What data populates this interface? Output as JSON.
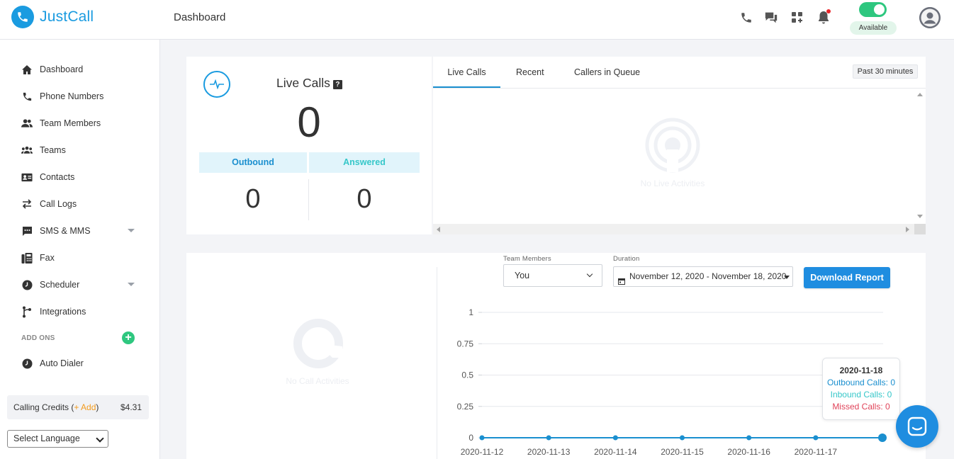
{
  "app": {
    "name": "JustCall"
  },
  "header": {
    "page_title": "Dashboard",
    "status_label": "Available",
    "icons": [
      "phone-icon",
      "chat-icon",
      "apps-icon",
      "bell-icon",
      "avatar-icon"
    ],
    "toggle_color": "#2ec77f",
    "accent": "#1a9be0"
  },
  "sidebar": {
    "items": [
      {
        "label": "Dashboard",
        "icon": "home-icon"
      },
      {
        "label": "Phone Numbers",
        "icon": "phone-icon"
      },
      {
        "label": "Team Members",
        "icon": "team-members-icon"
      },
      {
        "label": "Teams",
        "icon": "teams-icon"
      },
      {
        "label": "Contacts",
        "icon": "contacts-icon"
      },
      {
        "label": "Call Logs",
        "icon": "arrows-icon"
      },
      {
        "label": "SMS & MMS",
        "icon": "sms-icon"
      },
      {
        "label": "Fax",
        "icon": "fax-icon"
      },
      {
        "label": "Scheduler",
        "icon": "clock-icon"
      },
      {
        "label": "Integrations",
        "icon": "integrations-icon"
      }
    ],
    "addons_label": "ADD ONS",
    "addons_plus": "+",
    "addons": [
      {
        "label": "Auto Dialer",
        "icon": "clock-icon"
      }
    ],
    "credits": {
      "label": "Calling Credits (",
      "add": "+ Add",
      "close": ")",
      "amount": "$4.31"
    },
    "language": "Select Language"
  },
  "live_calls": {
    "title": "Live Calls",
    "help": "?",
    "count": "0",
    "outbound_label": "Outbound",
    "answered_label": "Answered",
    "outbound_count": "0",
    "answered_count": "0"
  },
  "activity": {
    "tabs": [
      {
        "label": "Live Calls"
      },
      {
        "label": "Recent"
      },
      {
        "label": "Callers in Queue"
      }
    ],
    "active_tab": "Live Calls",
    "range_button": "Past 30 minutes",
    "empty_text": "No Live Activities"
  },
  "report": {
    "empty_text": "No Call Activities",
    "team_members_label": "Team Members",
    "team_members_value": "You",
    "duration_label": "Duration",
    "duration_value": "November 12, 2020 - November 18, 2020",
    "download_label": "Download Report",
    "tooltip": {
      "date": "2020-11-18",
      "outbound": "Outbound Calls: 0",
      "inbound": "Inbound Calls: 0",
      "missed": "Missed Calls: 0"
    }
  },
  "chart_data": {
    "type": "line",
    "x": [
      "2020-11-12",
      "2020-11-13",
      "2020-11-14",
      "2020-11-15",
      "2020-11-16",
      "2020-11-17",
      "2020-11-18"
    ],
    "series": [
      {
        "values": [
          0,
          0,
          0,
          0,
          0,
          0,
          0
        ],
        "color": "#1a8fcf"
      }
    ],
    "yticks": [
      "1",
      "0.75",
      "0.5",
      "0.25",
      "0"
    ],
    "ylim": [
      0,
      1
    ],
    "grid": true
  }
}
